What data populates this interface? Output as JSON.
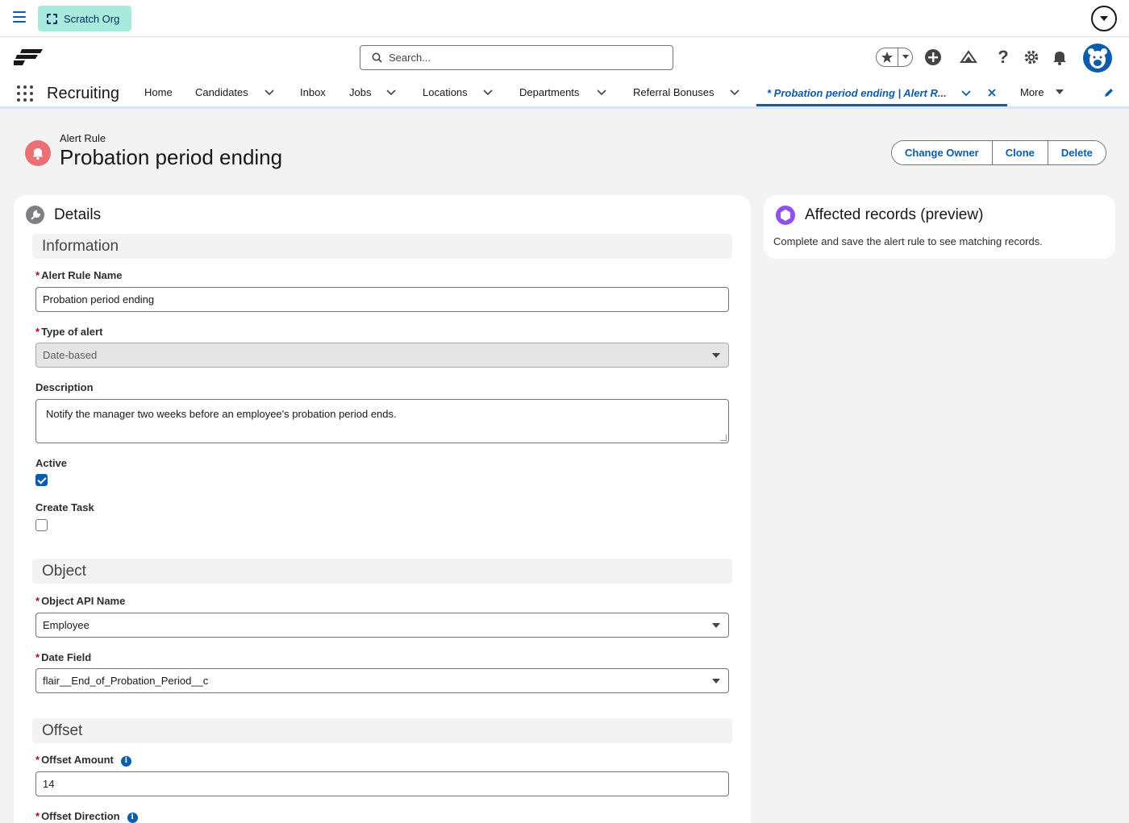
{
  "topbar": {
    "org_label": "Scratch Org"
  },
  "header": {
    "search_placeholder": "Search..."
  },
  "nav": {
    "app_name": "Recruiting",
    "items": [
      "Home",
      "Candidates",
      "Inbox",
      "Jobs",
      "Locations",
      "Departments",
      "Referral Bonuses"
    ],
    "active_tab": "* Probation period ending | Alert R...",
    "more_label": "More"
  },
  "record": {
    "type": "Alert Rule",
    "title": "Probation period ending",
    "actions": [
      "Change Owner",
      "Clone",
      "Delete"
    ]
  },
  "details": {
    "title": "Details",
    "sections": {
      "information": "Information",
      "object": "Object",
      "offset": "Offset"
    },
    "fields": {
      "alert_rule_name": {
        "label": "Alert Rule Name",
        "value": "Probation period ending"
      },
      "type_of_alert": {
        "label": "Type of alert",
        "value": "Date-based"
      },
      "description": {
        "label": "Description",
        "value": "Notify the manager two weeks before an employee's probation period ends."
      },
      "active": {
        "label": "Active",
        "checked": true
      },
      "create_task": {
        "label": "Create Task",
        "checked": false
      },
      "object_api_name": {
        "label": "Object API Name",
        "value": "Employee"
      },
      "date_field": {
        "label": "Date Field",
        "value": "flair__End_of_Probation_Period__c"
      },
      "offset_amount": {
        "label": "Offset Amount",
        "value": "14"
      },
      "offset_direction": {
        "label": "Offset Direction"
      }
    }
  },
  "affected": {
    "title": "Affected records (preview)",
    "message": "Complete and save the alert rule to see matching records."
  },
  "colors": {
    "brand": "#0b5cab",
    "required": "#ba0517",
    "alert_icon": "#ea7076",
    "org_pill": "#a8ebdc"
  }
}
